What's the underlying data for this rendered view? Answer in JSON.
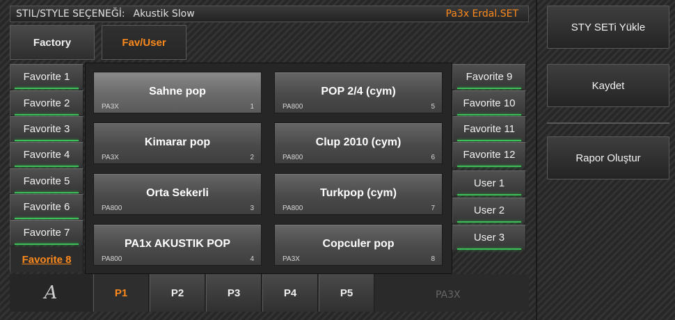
{
  "header": {
    "label": "STIL/STYLE SEÇENEĞİ:",
    "current_style": "Akustik Slow",
    "set_name": "Pa3x Erdal.SET"
  },
  "tabs": [
    {
      "label": "Factory",
      "active": false
    },
    {
      "label": "Fav/User",
      "active": true
    }
  ],
  "left_banks": [
    {
      "label": "Favorite 1"
    },
    {
      "label": "Favorite 2"
    },
    {
      "label": "Favorite 3"
    },
    {
      "label": "Favorite 4"
    },
    {
      "label": "Favorite 5"
    },
    {
      "label": "Favorite 6"
    },
    {
      "label": "Favorite 7"
    },
    {
      "label": "Favorite 8",
      "active": true
    }
  ],
  "right_banks": [
    {
      "label": "Favorite 9"
    },
    {
      "label": "Favorite 10"
    },
    {
      "label": "Favorite 11"
    },
    {
      "label": "Favorite 12"
    },
    {
      "label": "User 1"
    },
    {
      "label": "User 2"
    },
    {
      "label": "User 3"
    }
  ],
  "styles": [
    {
      "name": "Sahne pop",
      "bank": "PA3X",
      "num": "1",
      "selected": true
    },
    {
      "name": "Kimarar pop",
      "bank": "PA3X",
      "num": "2"
    },
    {
      "name": "Orta Sekerli",
      "bank": "PA800",
      "num": "3"
    },
    {
      "name": "PA1x AKUSTIK POP",
      "bank": "PA800",
      "num": "4"
    },
    {
      "name": "POP 2/4 (cym)",
      "bank": "PA800",
      "num": "5"
    },
    {
      "name": "Clup 2010 (cym)",
      "bank": "PA800",
      "num": "6"
    },
    {
      "name": "Turkpop (cym)",
      "bank": "PA800",
      "num": "7"
    },
    {
      "name": "Copculer pop",
      "bank": "PA3X",
      "num": "8"
    }
  ],
  "footer": {
    "logo_glyph": "A",
    "pages": [
      {
        "label": "P1",
        "active": true
      },
      {
        "label": "P2"
      },
      {
        "label": "P3"
      },
      {
        "label": "P4"
      },
      {
        "label": "P5"
      }
    ],
    "model": "PA3X"
  },
  "actions": {
    "load_set": "STY  SETi  Yükle",
    "save": "Kaydet",
    "report": "Rapor Oluştur"
  },
  "colors": {
    "accent": "#ff8a1c",
    "indicator": "#3fbf5a"
  }
}
